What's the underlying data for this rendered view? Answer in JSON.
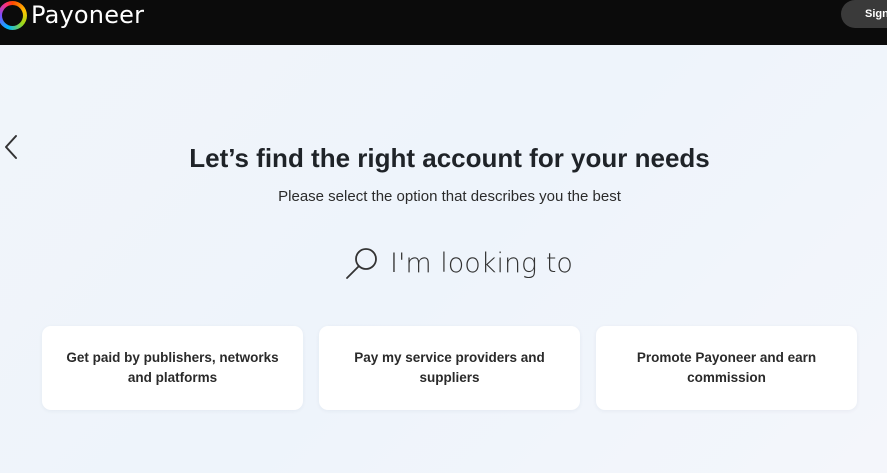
{
  "header": {
    "brand_name": "Payoneer",
    "signin_label": "Sign"
  },
  "main": {
    "title": "Let’s find the right account for your needs",
    "subtitle": "Please select the option that describes you the best",
    "looking_to": "I'm looking to",
    "options": [
      {
        "label": "Get paid by publishers, networks and platforms"
      },
      {
        "label": "Pay my service providers and suppliers"
      },
      {
        "label": "Promote Payoneer and earn commission"
      }
    ]
  },
  "icons": {
    "back": "chevron-left-icon",
    "search": "search-icon",
    "logo": "payoneer-logo-icon"
  },
  "colors": {
    "topbar": "#0b0b0b",
    "background": "#eef4fb",
    "card": "#ffffff",
    "signin_button": "#3a3a3a"
  }
}
